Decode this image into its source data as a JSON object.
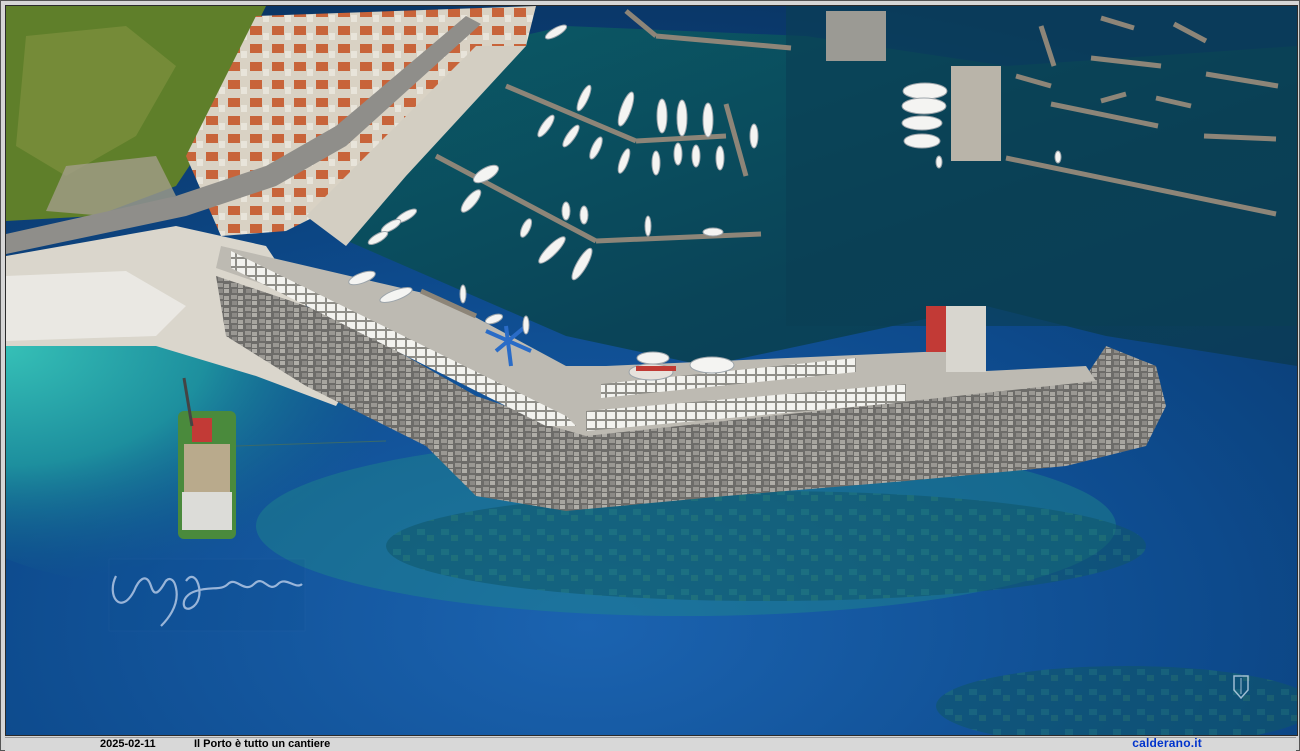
{
  "photo": {
    "subject": "Aerial view of a harbour with a breakwater, marina piers, moored boats, a work barge and a coastal town",
    "signature": "handwritten signature watermark",
    "emblem": "small coat-of-arms watermark"
  },
  "caption": {
    "date": "2025-02-11",
    "title": "Il Porto è tutto un cantiere",
    "site": "calderano.it"
  },
  "colors": {
    "deep_sea": "#0d3f7a",
    "harbour_water": "#0a4a5e",
    "shallow_water": "#1aa3a6",
    "breakwater": "#7d7c78",
    "quay": "#bdbab2",
    "vegetation": "#5f7f2a",
    "site_link": "#0033cc"
  }
}
